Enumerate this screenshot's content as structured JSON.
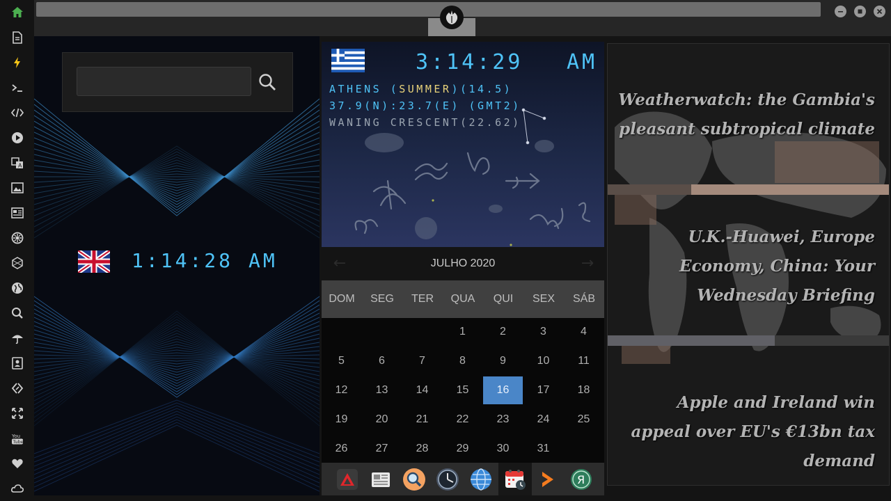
{
  "sidebar": {
    "items": [
      {
        "icon": "home-icon",
        "color": "#4caf50"
      },
      {
        "icon": "document-icon"
      },
      {
        "icon": "lightning-icon",
        "color": "#f5c518"
      },
      {
        "icon": "terminal-icon"
      },
      {
        "icon": "code-icon"
      },
      {
        "icon": "play-icon"
      },
      {
        "icon": "translate-icon"
      },
      {
        "icon": "image-icon"
      },
      {
        "icon": "news-icon"
      },
      {
        "icon": "settings-cog-icon"
      },
      {
        "icon": "hexagon-icon"
      },
      {
        "icon": "globe-icon"
      },
      {
        "icon": "search-icon"
      },
      {
        "icon": "umbrella-icon"
      },
      {
        "icon": "contacts-icon"
      },
      {
        "icon": "tag-link-icon"
      },
      {
        "icon": "fullscreen-icon"
      },
      {
        "icon": "youtube-icon"
      },
      {
        "icon": "heart-icon"
      },
      {
        "icon": "cloud-icon"
      }
    ]
  },
  "topbar": {
    "logo_icon": "rebel-alliance-icon"
  },
  "left_clock": {
    "search_placeholder": "",
    "flag": "uk-flag",
    "time": "1:14:28",
    "ampm": "AM"
  },
  "athens_clock": {
    "flag": "greece-flag",
    "time": "3:14:29",
    "ampm": "AM",
    "line1_a": "ATHENS (",
    "line1_b": "SUMMER",
    "line1_c": ")(14.5)",
    "line2": "37.9(N):23.7(E) (GMT2)",
    "line3": "WANING CRESCENT(22.62)"
  },
  "calendar": {
    "title": "JULHO 2020",
    "prev": "←",
    "next": "→",
    "weekdays": [
      "DOM",
      "SEG",
      "TER",
      "QUA",
      "QUI",
      "SEX",
      "SÁB"
    ],
    "weeks": [
      [
        "",
        "",
        "",
        "1",
        "2",
        "3",
        "4"
      ],
      [
        "5",
        "6",
        "7",
        "8",
        "9",
        "10",
        "11"
      ],
      [
        "12",
        "13",
        "14",
        "15",
        "16",
        "17",
        "18"
      ],
      [
        "19",
        "20",
        "21",
        "22",
        "23",
        "24",
        "25"
      ],
      [
        "26",
        "27",
        "28",
        "29",
        "30",
        "31",
        ""
      ]
    ],
    "today": "16",
    "today_color": "#4a86c8"
  },
  "dock": {
    "items": [
      {
        "icon": "red-triangle-app-icon"
      },
      {
        "icon": "newspaper-app-icon"
      },
      {
        "icon": "magnifier-app-icon"
      },
      {
        "icon": "clock-app-icon"
      },
      {
        "icon": "globe-app-icon"
      },
      {
        "icon": "calendar-clock-app-icon",
        "active": true
      },
      {
        "icon": "orange-chevron-app-icon"
      },
      {
        "icon": "translator-app-icon"
      }
    ]
  },
  "news": {
    "headlines": [
      {
        "text": "Weatherwatch: the Gambia's pleasant subtropical climate"
      },
      {
        "text": "U.K.-Huawei, Europe Economy, China: Your Wednesday Briefing"
      },
      {
        "text": "Apple and Ireland win appeal over EU's €13bn tax demand"
      }
    ]
  }
}
